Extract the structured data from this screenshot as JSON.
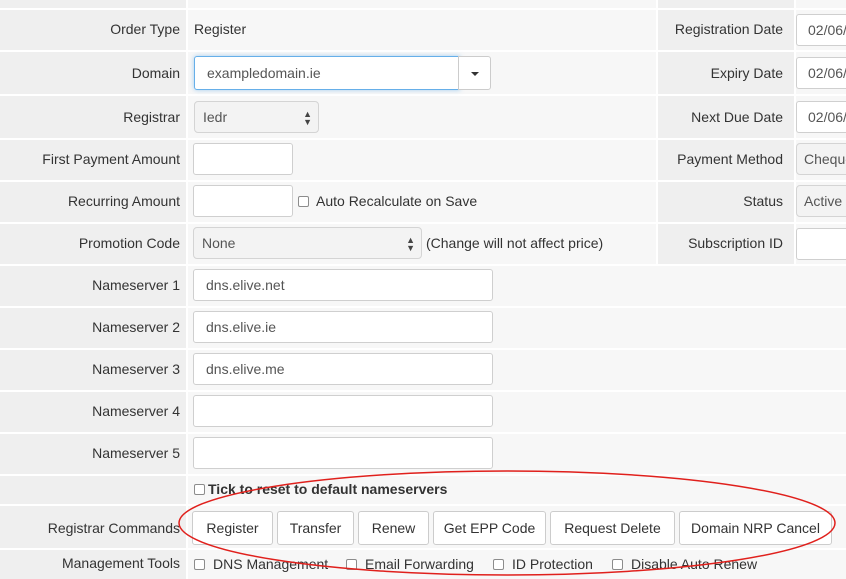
{
  "left": {
    "order_type": {
      "label": "Order Type",
      "value": "Register"
    },
    "domain": {
      "label": "Domain",
      "value": "exampledomain.ie"
    },
    "registrar": {
      "label": "Registrar",
      "value": "Iedr"
    },
    "first_payment": {
      "label": "First Payment Amount",
      "value": ""
    },
    "recurring": {
      "label": "Recurring Amount",
      "value": "",
      "auto_recalc_label": "Auto Recalculate on Save"
    },
    "promotion": {
      "label": "Promotion Code",
      "value": "None",
      "note": "(Change will not affect price)"
    },
    "nameservers": [
      {
        "label": "Nameserver 1",
        "value": "dns.elive.net"
      },
      {
        "label": "Nameserver 2",
        "value": "dns.elive.ie"
      },
      {
        "label": "Nameserver 3",
        "value": "dns.elive.me"
      },
      {
        "label": "Nameserver 4",
        "value": ""
      },
      {
        "label": "Nameserver 5",
        "value": ""
      }
    ],
    "reset_ns_label": "Tick to reset to default nameservers",
    "registrar_commands": {
      "label": "Registrar Commands",
      "buttons": [
        "Register",
        "Transfer",
        "Renew",
        "Get EPP Code",
        "Request Delete",
        "Domain NRP Cancel"
      ]
    },
    "management_tools": {
      "label": "Management Tools",
      "items": [
        "DNS Management",
        "Email Forwarding",
        "ID Protection",
        "Disable Auto Renew"
      ]
    }
  },
  "right": {
    "registration_date": {
      "label": "Registration Date",
      "value": "02/06/"
    },
    "expiry_date": {
      "label": "Expiry Date",
      "value": "02/06/"
    },
    "next_due_date": {
      "label": "Next Due Date",
      "value": "02/06/"
    },
    "payment_method": {
      "label": "Payment Method",
      "value": "Cheque"
    },
    "status": {
      "label": "Status",
      "value": "Active"
    },
    "subscription_id": {
      "label": "Subscription ID",
      "value": ""
    }
  },
  "colors": {
    "highlight_ellipse": "#e0201c",
    "focus_border": "#66afe9"
  }
}
